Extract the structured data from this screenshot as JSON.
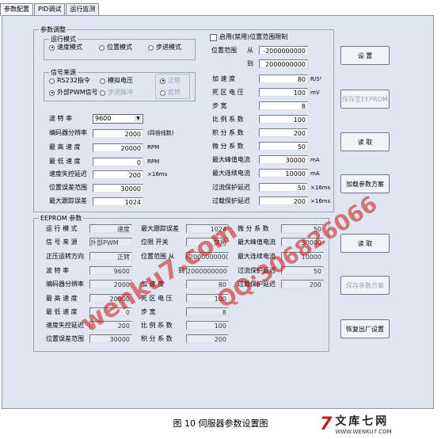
{
  "tabs": [
    "参数配置",
    "PID调试",
    "运行监测"
  ],
  "params_group": "参数调整",
  "run_mode": {
    "title": "运行模式",
    "options": [
      "速度模式",
      "位置模式",
      "步进模式"
    ],
    "selected": 0
  },
  "signal": {
    "title": "信号来源",
    "options": [
      "RS232指令",
      "模拟电压",
      "外部PWM信号",
      "步进脉冲"
    ],
    "selected": 2,
    "dir": [
      "正转",
      "反转"
    ]
  },
  "left_fields": [
    {
      "label": "波 特 率",
      "value": "9600",
      "unit": ""
    },
    {
      "label": "编码器分辨率",
      "value": "2000",
      "unit": "(四倍线数)"
    },
    {
      "label": "最 高 速 度",
      "value": "20000",
      "unit": "RPM"
    },
    {
      "label": "最 低 速 度",
      "value": "0",
      "unit": "RPM"
    },
    {
      "label": "速度失控延迟",
      "value": "200",
      "unit": "×16ms"
    },
    {
      "label": "位置误差范围",
      "value": "30000",
      "unit": ""
    },
    {
      "label": "最大跟踪误差",
      "value": "1024",
      "unit": ""
    }
  ],
  "pos_limit": {
    "label": "启用(禁用)位置范围限制",
    "range_label": "位置范围",
    "from_label": "从",
    "from": "-2000000000",
    "to_label": "到",
    "to": "2000000000"
  },
  "right_fields": [
    {
      "label": "加 速 度",
      "value": "80",
      "unit": "R/S²"
    },
    {
      "label": "死 区 电 压",
      "value": "100",
      "unit": "mV"
    },
    {
      "label": "步 宽",
      "value": "8",
      "unit": ""
    },
    {
      "label": "比 例 系 数",
      "value": "100",
      "unit": ""
    },
    {
      "label": "积 分 系 数",
      "value": "200",
      "unit": ""
    },
    {
      "label": "微 分 系 数",
      "value": "50",
      "unit": ""
    },
    {
      "label": "最大峰值电流",
      "value": "30000",
      "unit": "mA"
    },
    {
      "label": "最大连续电流",
      "value": "10000",
      "unit": "mA"
    },
    {
      "label": "过流保护延迟",
      "value": "50",
      "unit": "×16ms"
    },
    {
      "label": "过载保护延迟",
      "value": "200",
      "unit": "×16ms"
    }
  ],
  "buttons": {
    "set": "设 置",
    "save_eeprom": "保存至EEPROM",
    "read_top": "读 取",
    "load_scheme": "加载参数方案",
    "read": "读 取",
    "save_scheme": "保存参数方案",
    "restore": "恢复出厂设置"
  },
  "eeprom": {
    "title": "EEPROM 参数",
    "col1": [
      {
        "label": "运 行 模 式",
        "value": "速度"
      },
      {
        "label": "信 号 来 源",
        "value": "外部PWM"
      },
      {
        "label": "正压运转方向",
        "value": "正转"
      },
      {
        "label": "波 特 率",
        "value": "9600"
      },
      {
        "label": "编码器分辨率",
        "value": "2000"
      },
      {
        "label": "最 高 速 度",
        "value": "20000"
      },
      {
        "label": "最 低 速 度",
        "value": "0"
      },
      {
        "label": "速度失控延迟",
        "value": "200"
      },
      {
        "label": "位置误差范围",
        "value": "30000"
      }
    ],
    "col2": [
      {
        "label": "最大跟踪误差",
        "value": "1024"
      },
      {
        "label": "位限 开关",
        "value": "禁用"
      },
      {
        "label": "位置范围 从",
        "value": "-2000000000"
      },
      {
        "label": "到",
        "value": "2000000000"
      },
      {
        "label": "加 速 度",
        "value": "80"
      },
      {
        "label": "死 区 电 压",
        "value": "100"
      },
      {
        "label": "步 宽",
        "value": "8"
      },
      {
        "label": "比 例 系 数",
        "value": "100"
      },
      {
        "label": "积 分 系 数",
        "value": "200"
      }
    ],
    "col3": [
      {
        "label": "微 分 系 数",
        "value": "50"
      },
      {
        "label": "最大峰值电流",
        "value": "30000"
      },
      {
        "label": "最大连续电流",
        "value": "10000"
      },
      {
        "label": "过流保护延迟",
        "value": "50"
      },
      {
        "label": "过载保护延迟",
        "value": "200"
      }
    ]
  },
  "caption": "图 10   伺服器参数设置图",
  "watermarks": [
    "wenku7.com",
    "QQ:306826066"
  ],
  "brand": {
    "logo": "7",
    "name": "文库七网",
    "url": "WWW.WENKU7.COM"
  },
  "colors": {
    "window_bg": "#dfe6f2",
    "watermark": "#c81414"
  }
}
